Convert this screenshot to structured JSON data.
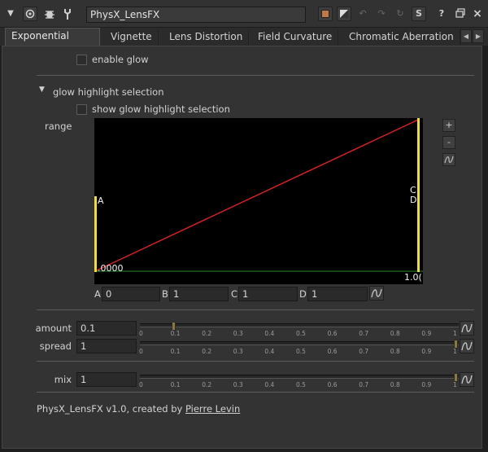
{
  "window": {
    "node_name": "PhysX_LensFX"
  },
  "toolbar": {
    "collapse_icon": "triangle-down-icon",
    "view_icon": "viewer-icon",
    "bug_icon": "bug-icon",
    "wrench_icon": "wrench-icon",
    "help_label": "?",
    "float_label": "float-window-icon",
    "close_label": "close-icon",
    "s_label": "S",
    "color_swatch": "#c07a4a"
  },
  "tabs": [
    {
      "label": "Exponential Glow",
      "active": true
    },
    {
      "label": "Vignette"
    },
    {
      "label": "Lens Distortion"
    },
    {
      "label": "Field Curvature"
    },
    {
      "label": "Chromatic Aberration"
    }
  ],
  "panel": {
    "enable_glow_label": "enable glow",
    "glow_highlight_section": "glow highlight selection",
    "show_glow_highlight_label": "show glow highlight selection",
    "range_label": "range",
    "curve": {
      "label_a": "A",
      "label_c": "C",
      "label_d": "D",
      "label_zero": ".0000",
      "label_one": "1.0(",
      "line_color": "#e02020",
      "bar_color": "#f0e020",
      "baseline_color": "#2a8a2a"
    },
    "curve_buttons": {
      "plus": "+",
      "minus": "-"
    },
    "abcd": [
      {
        "label": "A",
        "value": "0"
      },
      {
        "label": "B",
        "value": "1"
      },
      {
        "label": "C",
        "value": "1"
      },
      {
        "label": "D",
        "value": "1"
      }
    ],
    "amount": {
      "label": "amount",
      "value": "0.1",
      "level": 0.1
    },
    "spread": {
      "label": "spread",
      "value": "1",
      "level": 1
    },
    "mix": {
      "label": "mix",
      "value": "1",
      "level": 1
    },
    "slider_ticks": [
      "0",
      "0.1",
      "0.2",
      "0.3",
      "0.4",
      "0.5",
      "0.6",
      "0.7",
      "0.8",
      "0.9",
      "1"
    ],
    "footer_prefix": "PhysX_LensFX v1.0, created by ",
    "footer_author": "Pierre Levin"
  }
}
